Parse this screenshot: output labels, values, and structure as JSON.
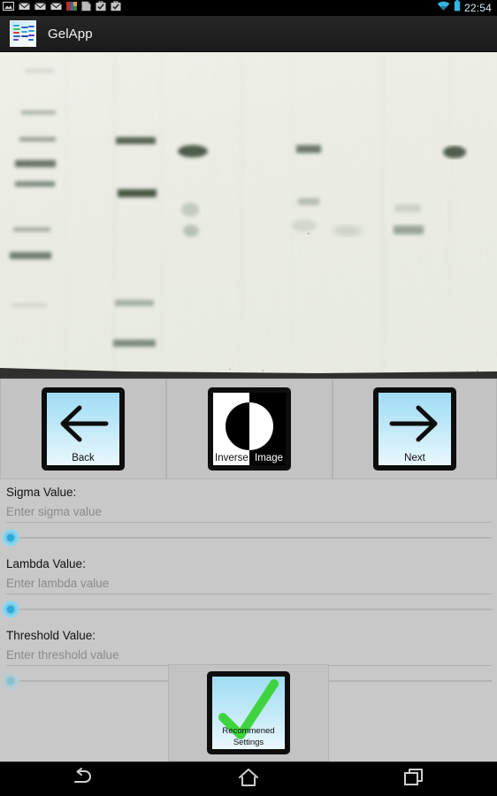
{
  "statusbar": {
    "clock": "22:54",
    "icons": [
      {
        "name": "screenshot-icon"
      },
      {
        "name": "email-icon"
      },
      {
        "name": "email-icon"
      },
      {
        "name": "email-icon"
      },
      {
        "name": "photo-icon"
      },
      {
        "name": "document-icon"
      },
      {
        "name": "task-complete-icon"
      },
      {
        "name": "task-complete-icon"
      }
    ],
    "wifi_icon": "wifi-icon",
    "battery_icon": "battery-icon",
    "accent_color": "#33b5e5"
  },
  "actionbar": {
    "title": "GelApp",
    "logo_icon": "gelapp-logo-icon",
    "background_color": "#1d1d1d"
  },
  "gel": {
    "alt": "gel-electrophoresis-image",
    "background_color": "#eef0e9"
  },
  "buttons": {
    "back": {
      "label": "Back",
      "icon": "arrow-left-icon"
    },
    "inverse": {
      "label_left": "Inverse",
      "label_right": "Image",
      "icon": "inverse-image-icon"
    },
    "next": {
      "label": "Next",
      "icon": "arrow-right-icon"
    },
    "recommended": {
      "label": "Recommened Settings",
      "icon": "check-mark-icon",
      "accent_color": "#3fd43f"
    }
  },
  "form": {
    "sigma": {
      "label": "Sigma Value:",
      "value": "",
      "placeholder": "Enter sigma value",
      "slider_value": 0
    },
    "lambda": {
      "label": "Lambda Value:",
      "value": "",
      "placeholder": "Enter lambda value",
      "slider_value": 0
    },
    "threshold": {
      "label": "Threshold Value:",
      "value": "",
      "placeholder": "Enter threshold value",
      "slider_value": 0
    }
  },
  "navbar": {
    "back": "nav-back-icon",
    "home": "nav-home-icon",
    "recents": "nav-recents-icon"
  }
}
